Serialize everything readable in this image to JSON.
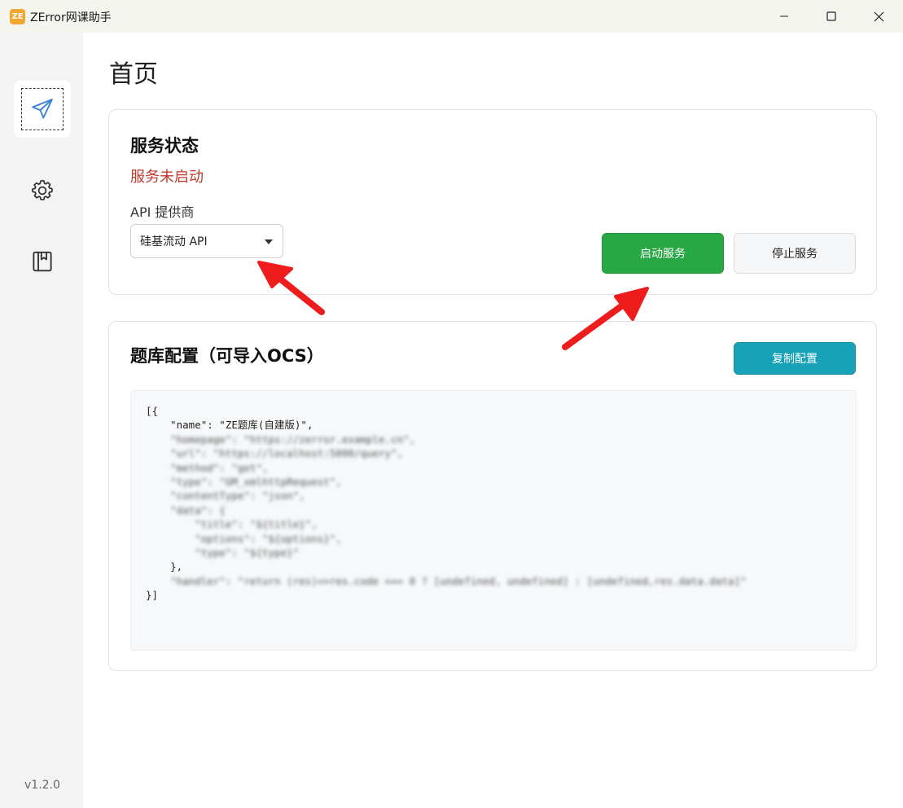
{
  "window": {
    "logo_text": "ZE",
    "title": "ZError网课助手"
  },
  "sidebar": {
    "items": [
      {
        "name": "home",
        "icon": "send-icon",
        "active": true
      },
      {
        "name": "settings",
        "icon": "gear-icon",
        "active": false
      },
      {
        "name": "docs",
        "icon": "book-icon",
        "active": false
      }
    ],
    "version": "v1.2.0"
  },
  "page": {
    "title": "首页"
  },
  "service_card": {
    "title": "服务状态",
    "status": "服务未启动",
    "status_color": "#c0392b",
    "provider_label": "API 提供商",
    "provider_selected": "硅基流动 API",
    "start_label": "启动服务",
    "stop_label": "停止服务",
    "start_color": "#28a745"
  },
  "config_card": {
    "title": "题库配置（可导入OCS）",
    "copy_label": "复制配置",
    "copy_color": "#17a2b8",
    "code_lines": [
      "[{",
      "    \"name\": \"ZE题库(自建版)\",",
      "    \"homepage\": \"https://zerror.example.cn\",",
      "    \"url\": \"https://localhost:5000/query\",",
      "    \"method\": \"get\",",
      "    \"type\": \"GM_xmlhttpRequest\",",
      "    \"contentType\": \"json\",",
      "    \"data\": {",
      "        \"title\": \"${title}\",",
      "        \"options\": \"${options}\",",
      "        \"type\": \"${type}\"",
      "    },",
      "    \"handler\": \"return (res)=>res.code === 0 ? [undefined, undefined] : [undefined,res.data.data]\"",
      "}]"
    ]
  }
}
